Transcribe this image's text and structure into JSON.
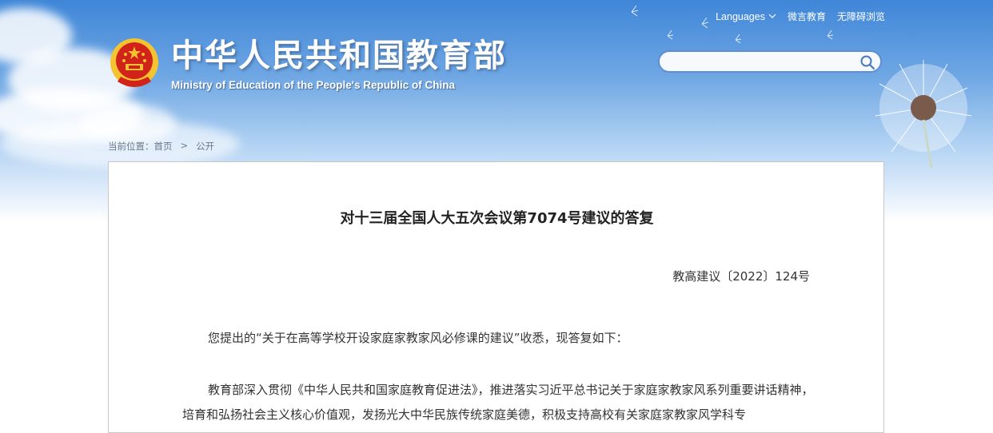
{
  "header": {
    "site_title": "中华人民共和国教育部",
    "site_subtitle": "Ministry of Education of the People's Republic of China",
    "top_links": {
      "languages": "Languages",
      "weiyan": "微言教育",
      "accessible": "无障碍浏览"
    },
    "search": {
      "placeholder": ""
    }
  },
  "breadcrumb": {
    "prefix": "当前位置：",
    "home": "首页",
    "separator": ">",
    "current": "公开"
  },
  "article": {
    "title": "对十三届全国人大五次会议第7074号建议的答复",
    "doc_number": "教高建议〔2022〕124号",
    "paragraphs": [
      "您提出的“关于在高等学校开设家庭家教家风必修课的建议”收悉，现答复如下：",
      "教育部深入贯彻《中华人民共和国家庭教育促进法》，推进落实习近平总书记关于家庭家教家风系列重要讲话精神，培育和弘扬社会主义核心价值观，发扬光大中华民族传统家庭美德，积极支持高校有关家庭家教家风学科专"
    ]
  },
  "colors": {
    "sky_top": "#3f86d8",
    "search_border": "#5f8ed2",
    "emblem_red": "#d2231b",
    "emblem_gold": "#f4c430"
  }
}
